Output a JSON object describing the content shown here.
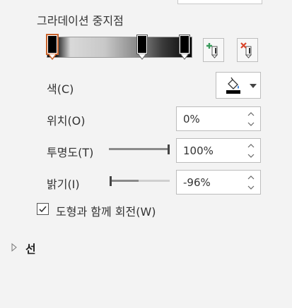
{
  "section": {
    "title": "그라데이션 중지점"
  },
  "gradient_stops": [
    {
      "position": 0,
      "color": "#000000",
      "selected": true
    },
    {
      "position": 64,
      "color": "#000000",
      "selected": false
    },
    {
      "position": 100,
      "color": "#000000",
      "selected": false
    }
  ],
  "buttons": {
    "add_stop_icon": "add-gradient-stop-icon",
    "remove_stop_icon": "remove-gradient-stop-icon",
    "fill_color_icon": "paint-bucket-icon"
  },
  "color": {
    "label": "색(C)",
    "swatch": "#000000"
  },
  "position": {
    "label": "위치(O)",
    "value": "0%"
  },
  "transparency": {
    "label": "투명도(T)",
    "value": "100%",
    "level": 100
  },
  "brightness": {
    "label": "밝기(I)",
    "value": "-96%",
    "level": -96
  },
  "rotate_with_shape": {
    "label": "도형과 함께 회전(W)",
    "checked": true
  },
  "line_section": {
    "label": "선",
    "expanded": false
  },
  "colors": {
    "accent": "#c8632c",
    "border": "#bcbcbc",
    "background": "#f3f3f3"
  }
}
